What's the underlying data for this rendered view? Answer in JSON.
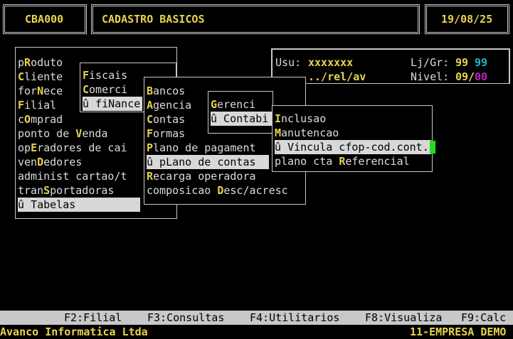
{
  "header": {
    "code": "CBA000",
    "title": "CADASTRO BASICOS",
    "date": "19/08/25"
  },
  "info": {
    "usu_label": "Usu:",
    "usu_value": "xxxxxxx",
    "lj_label": "Lj/Gr:",
    "lj_value1": "99",
    "lj_value2": "99",
    "path": "../rel/av",
    "nivel_label": "Nivel:",
    "nivel_value1": "09",
    "nivel_sep": "/",
    "nivel_value2": "00"
  },
  "menu_main": [
    {
      "pre": "p",
      "hot": "R",
      "post": "oduto"
    },
    {
      "pre": "",
      "hot": "C",
      "post": "liente"
    },
    {
      "pre": "for",
      "hot": "N",
      "post": "ece"
    },
    {
      "pre": "",
      "hot": "F",
      "post": "ilial"
    },
    {
      "pre": "c",
      "hot": "O",
      "post": "mprad"
    },
    {
      "pre": "ponto de ",
      "hot": "V",
      "post": "enda"
    },
    {
      "pre": "op",
      "hot": "E",
      "post": "radores de cai"
    },
    {
      "pre": "ven",
      "hot": "D",
      "post": "edores"
    },
    {
      "pre": "administ cartao/t",
      "hot": "",
      "post": ""
    },
    {
      "pre": "tran",
      "hot": "S",
      "post": "portadoras"
    },
    {
      "pre": "û ",
      "hot": "T",
      "post": "abelas",
      "selected": true
    }
  ],
  "menu_tabelas": [
    {
      "pre": "",
      "hot": "F",
      "post": "iscais"
    },
    {
      "pre": "",
      "hot": "C",
      "post": "omerci"
    },
    {
      "pre": "û fi",
      "hot": "N",
      "post": "ance",
      "selected": true
    }
  ],
  "menu_financeiro": [
    {
      "pre": "",
      "hot": "B",
      "post": "ancos"
    },
    {
      "pre": "",
      "hot": "A",
      "post": "gencia"
    },
    {
      "pre": "",
      "hot": "C",
      "post": "ontas"
    },
    {
      "pre": "",
      "hot": "F",
      "post": "ormas"
    },
    {
      "pre": "",
      "hot": "P",
      "post": "lano de pagament"
    },
    {
      "pre": "û p",
      "hot": "L",
      "post": "ano de contas",
      "selected": true
    },
    {
      "pre": "",
      "hot": "R",
      "post": "ecarga operadora"
    },
    {
      "pre": "composicao ",
      "hot": "D",
      "post": "esc/acresc"
    }
  ],
  "menu_plano": [
    {
      "pre": "",
      "hot": "G",
      "post": "erenci"
    },
    {
      "pre": "û Contabi",
      "hot": "",
      "post": "",
      "selected": true
    }
  ],
  "menu_contabil": [
    {
      "pre": "",
      "hot": "I",
      "post": "nclusao"
    },
    {
      "pre": "",
      "hot": "M",
      "post": "anutencao"
    },
    {
      "pre": "û Vincula cfop-cod.cont.",
      "hot": "",
      "post": "",
      "selected": true
    },
    {
      "pre": "plano cta ",
      "hot": "R",
      "post": "eferencial"
    }
  ],
  "fkeys": [
    {
      "label": "F2:Filial"
    },
    {
      "label": "F3:Consultas"
    },
    {
      "label": "F4:Utilitarios"
    },
    {
      "label": "F8:Visualiza"
    },
    {
      "label": "F9:Calc"
    }
  ],
  "status": {
    "company": "Avanco Informatica Ltda",
    "empresa": "11-EMPRESA DEMO"
  }
}
